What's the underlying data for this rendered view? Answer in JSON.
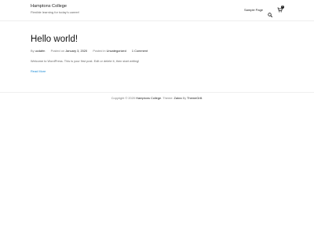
{
  "header": {
    "site_title": "Hamptons College",
    "tagline": "Flexible learning for today's career!",
    "nav": {
      "sample_page": "Sample Page"
    },
    "cart_count": "0"
  },
  "post": {
    "title": "Hello world!",
    "meta": {
      "by_label": "By",
      "author": "ucdafm",
      "posted_on_label": "Posted on",
      "date": "January 3, 2020",
      "posted_in_label": "Posted in",
      "category": "Uncategorized",
      "comments": "1 Comment"
    },
    "excerpt": "Welcome to WordPress. This is your first post. Edit or delete it, then start writing!",
    "read_more": "Read More"
  },
  "footer": {
    "copyright_prefix": "Copyright © 2020",
    "site_name": "Hamptons College",
    "theme_label": ". Theme:",
    "theme_name": "Zakra",
    "by_label": "By",
    "author": "ThemeGrill."
  },
  "icons": {
    "search": "search-icon",
    "cart": "cart-icon"
  }
}
